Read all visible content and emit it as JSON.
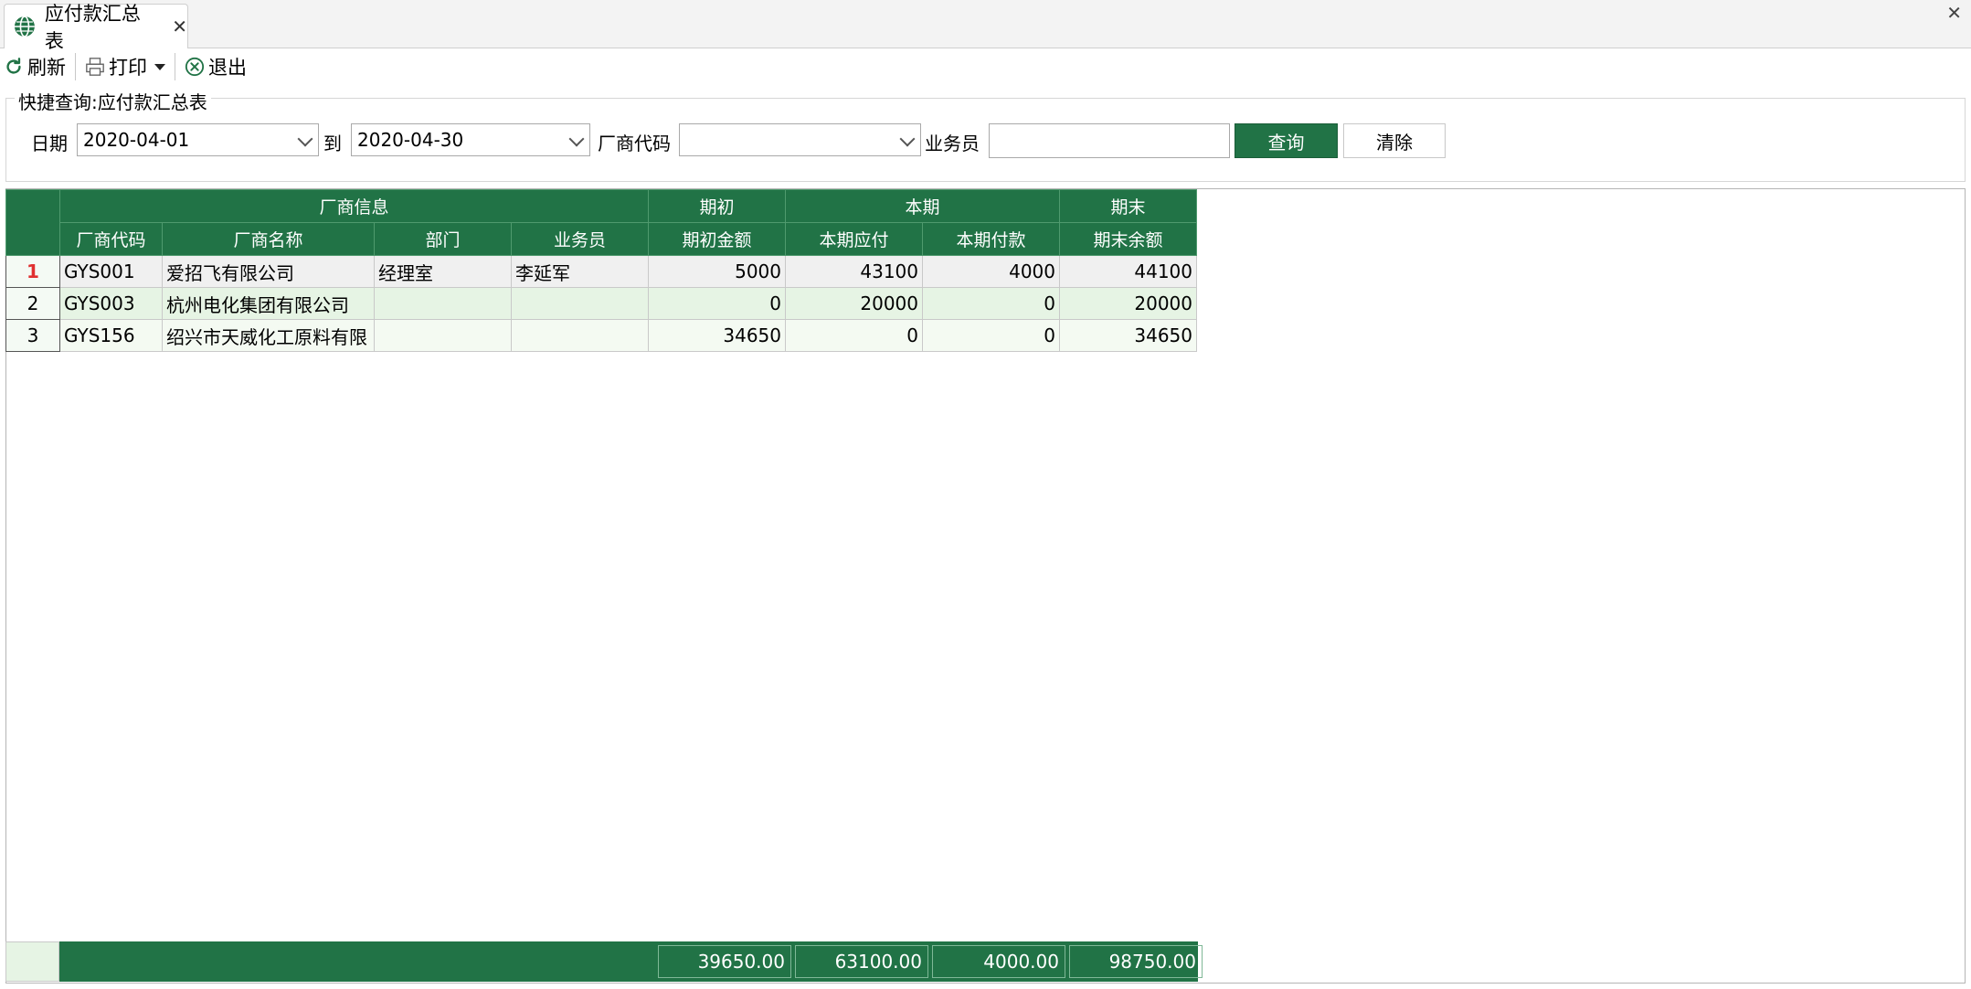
{
  "tab": {
    "title": "应付款汇总表",
    "close": "✕"
  },
  "window": {
    "close": "✕"
  },
  "toolbar": {
    "refresh": "刷新",
    "print": "打印",
    "exit": "退出"
  },
  "query": {
    "title": "快捷查询:应付款汇总表",
    "date_label": "日期",
    "date_from": "2020-04-01",
    "to_label": "到",
    "date_to": "2020-04-30",
    "vendor_code_label": "厂商代码",
    "vendor_code": "",
    "salesman_label": "业务员",
    "salesman": "",
    "search": "查询",
    "clear": "清除"
  },
  "grid": {
    "group_headers": {
      "vendor_info": "厂商信息",
      "opening": "期初",
      "current": "本期",
      "closing": "期末"
    },
    "columns": [
      "厂商代码",
      "厂商名称",
      "部门",
      "业务员",
      "期初金额",
      "本期应付",
      "本期付款",
      "期末余额"
    ],
    "rows": [
      {
        "no": "1",
        "code": "GYS001",
        "name": "爱招飞有限公司",
        "dept": "经理室",
        "salesman": "李延军",
        "opening": "5000",
        "payable": "43100",
        "paid": "4000",
        "closing": "44100"
      },
      {
        "no": "2",
        "code": "GYS003",
        "name": "杭州电化集团有限公司",
        "dept": "",
        "salesman": "",
        "opening": "0",
        "payable": "20000",
        "paid": "0",
        "closing": "20000"
      },
      {
        "no": "3",
        "code": "GYS156",
        "name": "绍兴市天威化工原料有限",
        "dept": "",
        "salesman": "",
        "opening": "34650",
        "payable": "0",
        "paid": "0",
        "closing": "34650"
      }
    ],
    "totals": {
      "opening": "39650.00",
      "payable": "63100.00",
      "paid": "4000.00",
      "closing": "98750.00"
    }
  },
  "colors": {
    "accent": "#217346",
    "row_alt": "#e6f4e4",
    "row_number_active": "#e03030"
  }
}
